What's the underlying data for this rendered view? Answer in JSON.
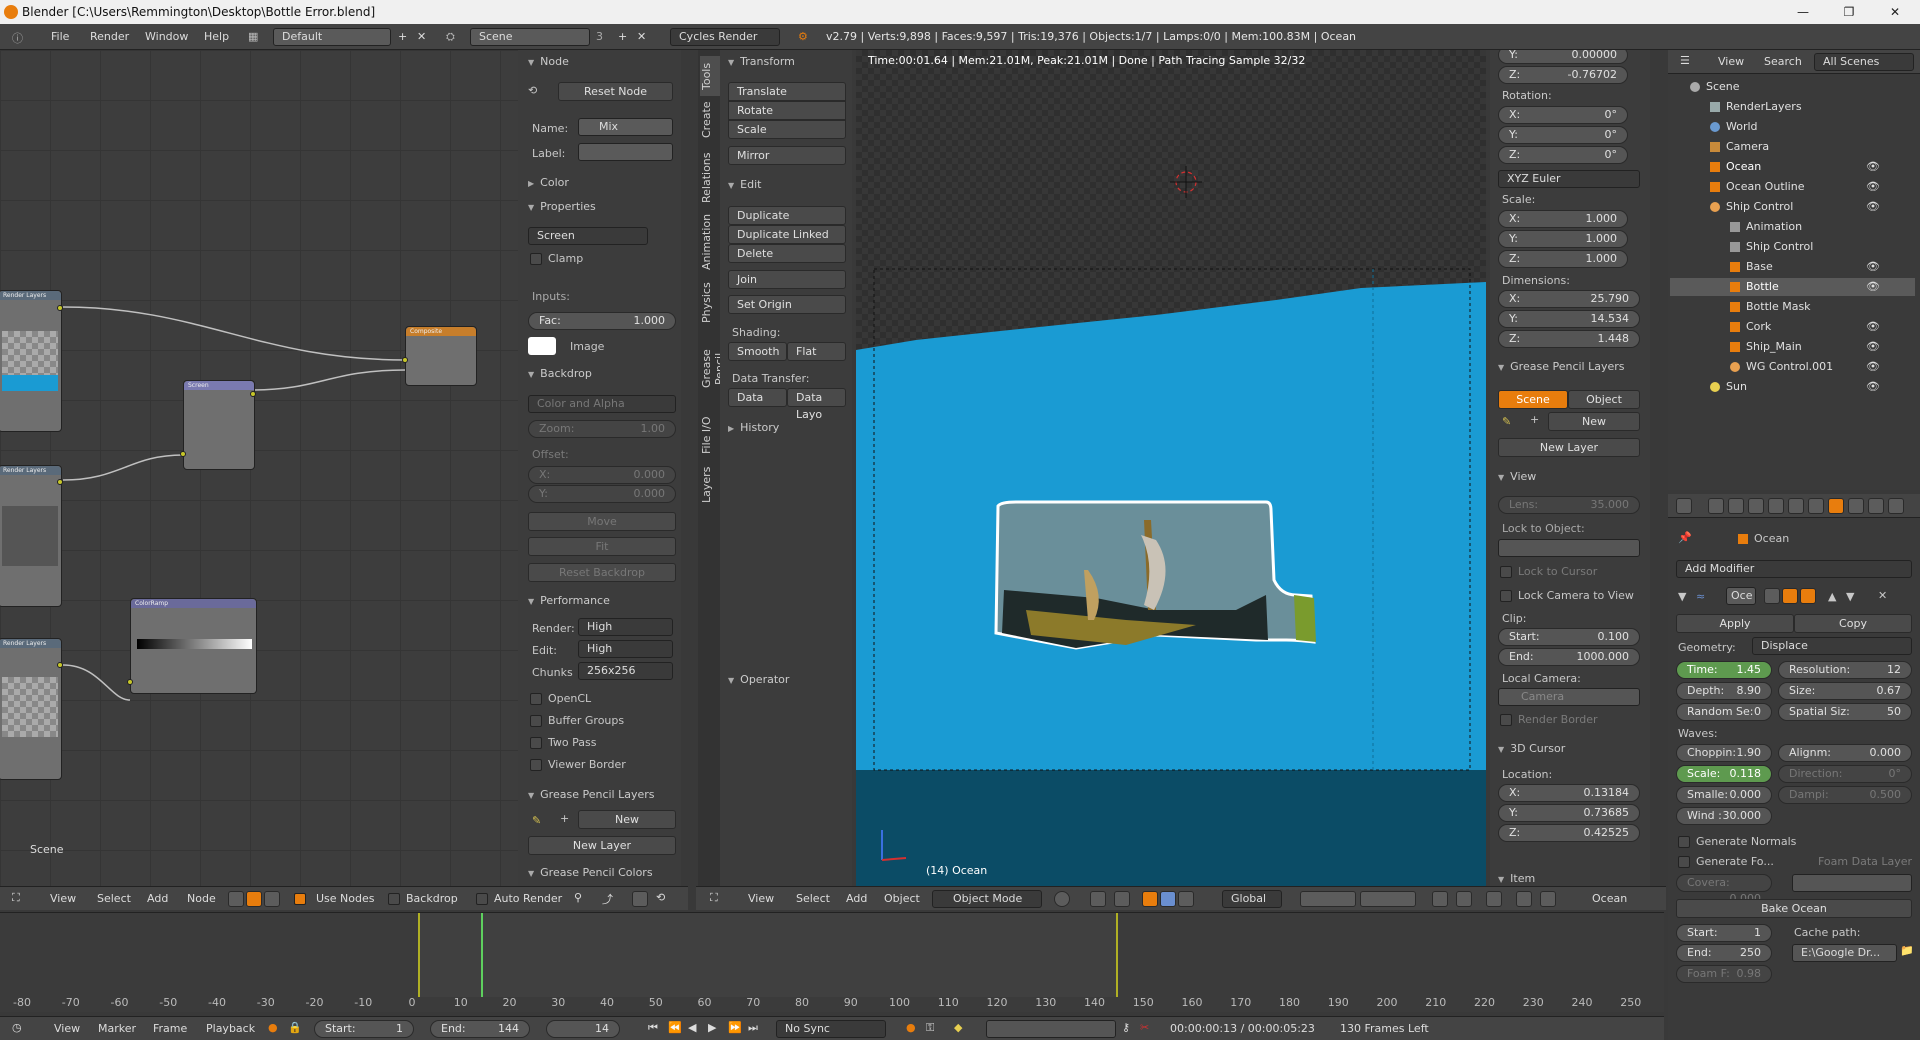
{
  "window": {
    "title": "Blender [C:\\Users\\Remmington\\Desktop\\Bottle Error.blend]",
    "minimize": "—",
    "maximize": "❐",
    "close": "✕"
  },
  "topbar": {
    "menus": [
      "File",
      "Render",
      "Window",
      "Help"
    ],
    "screen_layout": "Default",
    "scene": "Scene",
    "scene_users": "3",
    "engine": "Cycles Render",
    "stats": "v2.79 | Verts:9,898 | Faces:9,597 | Tris:19,376 | Objects:1/7 | Lamps:0/0 | Mem:100.83M | Ocean"
  },
  "node_editor": {
    "scene_label": "Scene",
    "footer": {
      "menus": [
        "View",
        "Select",
        "Add",
        "Node"
      ],
      "use_nodes": "Use Nodes",
      "backdrop": "Backdrop",
      "auto_render": "Auto Render"
    },
    "nodes": {
      "rl1": "Render Layers",
      "rl2": "Render Layers",
      "rl3": "Render Layers",
      "composite": "Composite",
      "screen": "Screen",
      "colorramp": "ColorRamp"
    }
  },
  "node_props": {
    "node_header": "Node",
    "reset_node": "Reset Node",
    "name_label": "Name:",
    "name_value": "Mix",
    "label_label": "Label:",
    "color": "Color",
    "properties": "Properties",
    "blend_mode": "Screen",
    "clamp": "Clamp",
    "inputs": "Inputs:",
    "fac_label": "Fac:",
    "fac_value": "1.000",
    "image": "Image",
    "backdrop": "Backdrop",
    "color_alpha": "Color and Alpha",
    "zoom_label": "Zoom:",
    "zoom_value": "1.00",
    "offset": "Offset:",
    "x_label": "X:",
    "x_value": "0.000",
    "y_label": "Y:",
    "y_value": "0.000",
    "move": "Move",
    "fit": "Fit",
    "reset_backdrop": "Reset Backdrop",
    "performance": "Performance",
    "render_label": "Render:",
    "render_value": "High",
    "edit_label": "Edit:",
    "edit_value": "High",
    "chunks_label": "Chunks",
    "chunks_value": "256x256",
    "opencl": "OpenCL",
    "buffer_groups": "Buffer Groups",
    "two_pass": "Two Pass",
    "viewer_border": "Viewer Border",
    "gp_layers": "Grease Pencil Layers",
    "gp_new": "New",
    "gp_new_layer": "New Layer",
    "gp_colors": "Grease Pencil Colors"
  },
  "tool_tabs": [
    "Tools",
    "Create",
    "Relations",
    "Animation",
    "Physics",
    "Grease Pencil",
    "File I/O",
    "Layers"
  ],
  "tools": {
    "transform": "Transform",
    "translate": "Translate",
    "rotate": "Rotate",
    "scale": "Scale",
    "mirror": "Mirror",
    "edit": "Edit",
    "duplicate": "Duplicate",
    "duplicate_linked": "Duplicate Linked",
    "delete": "Delete",
    "join": "Join",
    "set_origin": "Set Origin",
    "shading": "Shading:",
    "smooth": "Smooth",
    "flat": "Flat",
    "data_transfer": "Data Transfer:",
    "data": "Data",
    "data_layo": "Data Layo",
    "history": "History",
    "operator": "Operator"
  },
  "viewport": {
    "render_status": "Time:00:01.64 | Mem:21.01M, Peak:21.01M | Done | Path Tracing Sample 32/32",
    "object_label": "(14) Ocean",
    "footer": {
      "menus": [
        "View",
        "Select",
        "Add",
        "Object"
      ],
      "mode": "Object Mode",
      "orientation": "Global",
      "name": "Ocean"
    }
  },
  "n_panel": {
    "loc_y_label": "Y:",
    "loc_y": "0.00000",
    "loc_z_label": "Z:",
    "loc_z": "-0.76702",
    "rotation": "Rotation:",
    "rx": "0°",
    "ry": "0°",
    "rz": "0°",
    "euler": "XYZ Euler",
    "scale": "Scale:",
    "sx": "1.000",
    "sy": "1.000",
    "sz": "1.000",
    "dimensions": "Dimensions:",
    "dx": "25.790",
    "dy": "14.534",
    "dz": "1.448",
    "x": "X:",
    "y": "Y:",
    "z": "Z:",
    "gp_layers": "Grease Pencil Layers",
    "scene": "Scene",
    "object": "Object",
    "new": "New",
    "new_layer": "New Layer",
    "view": "View",
    "lens_label": "Lens:",
    "lens": "35.000",
    "lock_to_object": "Lock to Object:",
    "lock_to_cursor": "Lock to Cursor",
    "lock_camera": "Lock Camera to View",
    "clip": "Clip:",
    "start_label": "Start:",
    "start": "0.100",
    "end_label": "End:",
    "end": "1000.000",
    "local_camera": "Local Camera:",
    "camera": "Camera",
    "render_border": "Render Border",
    "cursor": "3D Cursor",
    "location": "Location:",
    "cx": "0.13184",
    "cy": "0.73685",
    "cz": "0.42525",
    "item": "Item"
  },
  "outliner": {
    "menus": [
      "View",
      "Search"
    ],
    "filter": "All Scenes",
    "rows": [
      {
        "name": "Scene",
        "indent": 0,
        "icon": "scene-icon"
      },
      {
        "name": "RenderLayers",
        "indent": 1,
        "icon": "renderlayers-icon"
      },
      {
        "name": "World",
        "indent": 1,
        "icon": "world-icon"
      },
      {
        "name": "Camera",
        "indent": 1,
        "icon": "camera-icon"
      },
      {
        "name": "Ocean",
        "indent": 1,
        "icon": "mesh-icon"
      },
      {
        "name": "Ocean Outline",
        "indent": 1,
        "icon": "mesh-icon"
      },
      {
        "name": "Ship Control",
        "indent": 1,
        "icon": "empty-icon"
      },
      {
        "name": "Animation",
        "indent": 2,
        "icon": "action-icon"
      },
      {
        "name": "Ship Control",
        "indent": 2,
        "icon": "empty-icon"
      },
      {
        "name": "Base",
        "indent": 2,
        "icon": "mesh-icon"
      },
      {
        "name": "Bottle",
        "indent": 2,
        "icon": "mesh-icon"
      },
      {
        "name": "Bottle Mask",
        "indent": 2,
        "icon": "mesh-icon"
      },
      {
        "name": "Cork",
        "indent": 2,
        "icon": "mesh-icon"
      },
      {
        "name": "Ship_Main",
        "indent": 2,
        "icon": "mesh-icon"
      },
      {
        "name": "WG Control.001",
        "indent": 2,
        "icon": "empty-icon"
      },
      {
        "name": "Sun",
        "indent": 1,
        "icon": "lamp-icon"
      }
    ]
  },
  "modifier": {
    "object": "Ocean",
    "add_modifier": "Add Modifier",
    "name": "Oce",
    "apply": "Apply",
    "copy": "Copy",
    "geometry_label": "Geometry:",
    "geometry": "Displace",
    "time_k": "Time:",
    "time_v": "1.45",
    "res_k": "Resolution:",
    "res_v": "12",
    "depth_k": "Depth:",
    "depth_v": "8.90",
    "size_k": "Size:",
    "size_v": "0.67",
    "seed_k": "Random Se:",
    "seed_v": "0",
    "spatial_k": "Spatial Siz:",
    "spatial_v": "50",
    "waves": "Waves:",
    "chop_k": "Choppin:",
    "chop_v": "1.90",
    "align_k": "Alignm:",
    "align_v": "0.000",
    "scale_k": "Scale:",
    "scale_v": "0.118",
    "dir_k": "Direction:",
    "dir_v": "0°",
    "small_k": "Smalle:",
    "small_v": "0.000",
    "damp_k": "Dampi:",
    "damp_v": "0.500",
    "wind_k": "Wind :",
    "wind_v": "30.000",
    "gen_normals": "Generate Normals",
    "gen_foam": "Generate Fo...",
    "foam_layer": "Foam Data Layer",
    "cov_k": "Covera:",
    "cov_v": "0.000",
    "bake": "Bake Ocean",
    "bstart_k": "Start:",
    "bstart_v": "1",
    "bend_k": "End:",
    "bend_v": "250",
    "cache": "Cache path:",
    "cache_v": "E:\\Google Dr...",
    "foam_k": "Foam F:",
    "foam_v": "0.98"
  },
  "timeline": {
    "ticks": [
      "-80",
      "-70",
      "-60",
      "-50",
      "-40",
      "-30",
      "-20",
      "-10",
      "0",
      "10",
      "20",
      "30",
      "40",
      "50",
      "60",
      "70",
      "80",
      "90",
      "100",
      "110",
      "120",
      "130",
      "140",
      "150",
      "160",
      "170",
      "180",
      "190",
      "200",
      "210",
      "220",
      "230",
      "240",
      "250"
    ],
    "menus": [
      "View",
      "Marker",
      "Frame",
      "Playback"
    ],
    "start_label": "Start:",
    "start": "1",
    "end_label": "End:",
    "end": "144",
    "current": "14",
    "sync": "No Sync",
    "time": "00:00:00:13 / 00:00:05:23",
    "frames_left": "130 Frames Left"
  },
  "colors": {
    "ocean": "#1a9bd3",
    "ocean_dark": "#0b4c66",
    "accent": "#e87d0d",
    "selected": "#5e9a4f"
  }
}
